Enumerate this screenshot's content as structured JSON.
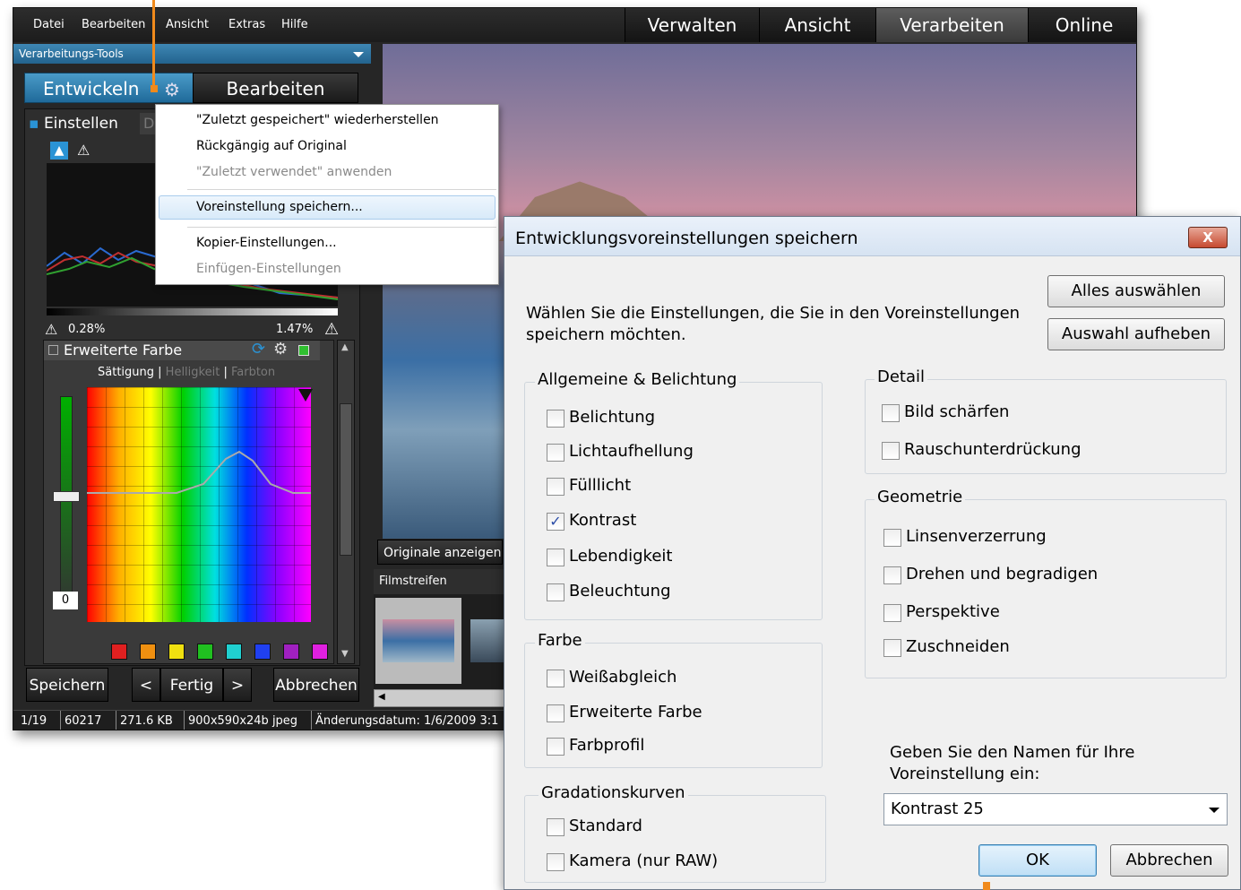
{
  "menubar": {
    "items": [
      "Datei",
      "Bearbeiten",
      "Ansicht",
      "Extras",
      "Hilfe"
    ],
    "modes": [
      "Verwalten",
      "Ansicht",
      "Verarbeiten",
      "Online"
    ]
  },
  "tools": {
    "header": "Verarbeitungs-Tools",
    "entwickeln": "Entwickeln",
    "bearbeiten": "Bearbeiten",
    "tab_einstellen": "Einstellen",
    "tab_detail": "De"
  },
  "histogram": {
    "left_pct": "0.28%",
    "right_pct": "1.47%"
  },
  "ext_color": {
    "title": "Erweiterte Farbe",
    "tabs": [
      "Sättigung",
      "Helligkeit",
      "Farbton"
    ],
    "slider_value": "0",
    "swatch_colors": [
      "#e02020",
      "#f09010",
      "#f0e010",
      "#20c020",
      "#20d0d0",
      "#2040f0",
      "#a020c0",
      "#e020e0"
    ]
  },
  "bottom": {
    "save": "Speichern",
    "prev": "<",
    "done": "Fertig",
    "next": ">",
    "cancel": "Abbrechen"
  },
  "status": {
    "index": "1/19",
    "id": "60217",
    "size": "271.6 KB",
    "dims": "900x590x24b jpeg",
    "date": "Änderungsdatum: 1/6/2009 3:1"
  },
  "viewer": {
    "show_originals": "Originale anzeigen",
    "filmstrip": "Filmstreifen"
  },
  "context_menu": {
    "items": [
      {
        "label": "\"Zuletzt gespeichert\" wiederherstellen",
        "disabled": false
      },
      {
        "label": "Rückgängig auf Original",
        "disabled": false
      },
      {
        "label": "\"Zuletzt verwendet\" anwenden",
        "disabled": true
      },
      {
        "label": "Voreinstellung speichern...",
        "disabled": false
      },
      {
        "label": "Kopier-Einstellungen...",
        "disabled": false
      },
      {
        "label": "Einfügen-Einstellungen",
        "disabled": true
      }
    ]
  },
  "dialog": {
    "title": "Entwicklungsvoreinstellungen speichern",
    "close": "X",
    "instruction": "Wählen Sie die Einstellungen, die Sie in den Voreinstellungen speichern möchten.",
    "select_all": "Alles auswählen",
    "deselect": "Auswahl aufheben",
    "groups": {
      "general": {
        "label": "Allgemeine & Belichtung",
        "items": [
          {
            "label": "Belichtung",
            "checked": false
          },
          {
            "label": "Lichtaufhellung",
            "checked": false
          },
          {
            "label": "Fülllicht",
            "checked": false
          },
          {
            "label": "Kontrast",
            "checked": true
          },
          {
            "label": "Lebendigkeit",
            "checked": false
          },
          {
            "label": "Beleuchtung",
            "checked": false
          }
        ]
      },
      "color": {
        "label": "Farbe",
        "items": [
          {
            "label": "Weißabgleich",
            "checked": false
          },
          {
            "label": "Erweiterte Farbe",
            "checked": false
          },
          {
            "label": "Farbprofil",
            "checked": false
          }
        ]
      },
      "curves": {
        "label": "Gradationskurven",
        "items": [
          {
            "label": "Standard",
            "checked": false
          },
          {
            "label": "Kamera (nur RAW)",
            "checked": false
          }
        ]
      },
      "detail": {
        "label": "Detail",
        "items": [
          {
            "label": "Bild schärfen",
            "checked": false
          },
          {
            "label": "Rauschunterdrückung",
            "checked": false
          }
        ]
      },
      "geometry": {
        "label": "Geometrie",
        "items": [
          {
            "label": "Linsenverzerrung",
            "checked": false
          },
          {
            "label": "Drehen und begradigen",
            "checked": false
          },
          {
            "label": "Perspektive",
            "checked": false
          },
          {
            "label": "Zuschneiden",
            "checked": false
          }
        ]
      }
    },
    "name_prompt": "Geben Sie den Namen für Ihre Voreinstellung ein:",
    "name_value": "Kontrast 25",
    "ok": "OK",
    "cancel": "Abbrechen"
  }
}
